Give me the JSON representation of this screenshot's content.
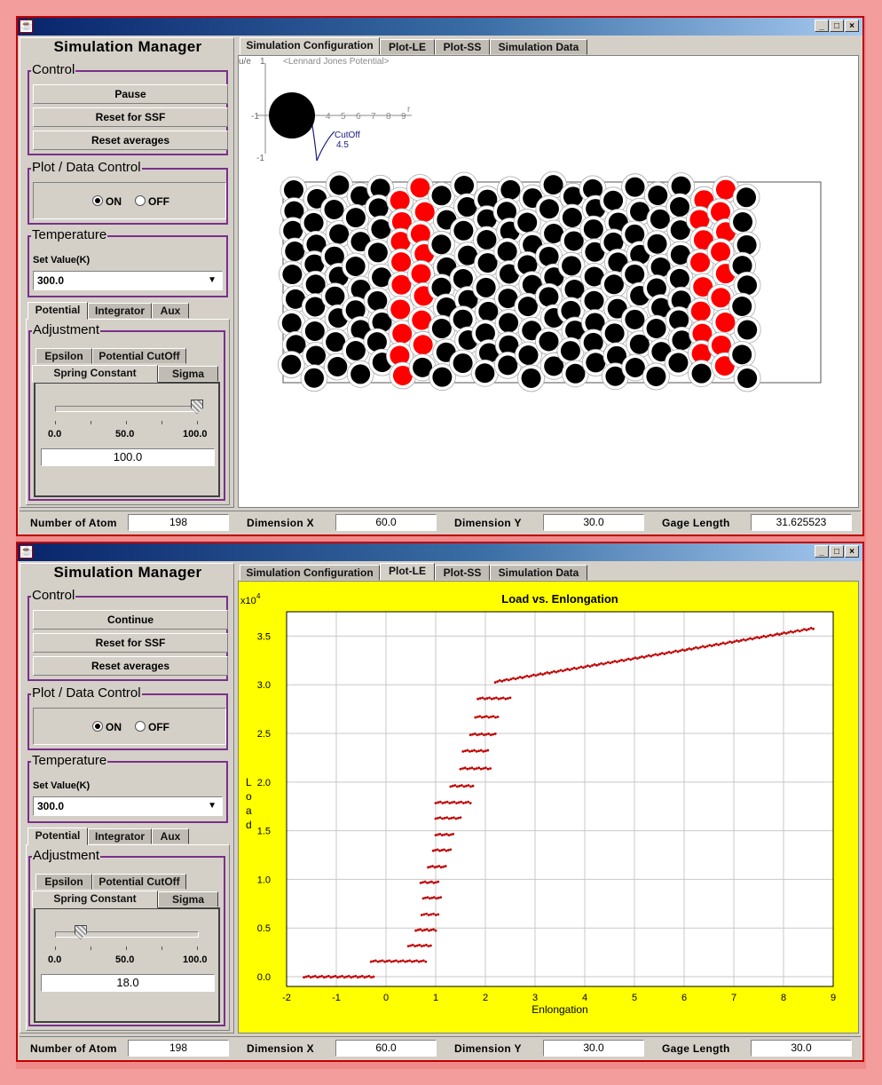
{
  "windows": [
    {
      "id": "win1",
      "manager_title": "Simulation Manager",
      "control": {
        "title": "Control",
        "buttons": [
          "Pause",
          "Reset for SSF",
          "Reset averages"
        ]
      },
      "plot_control": {
        "title": "Plot / Data Control",
        "on_label": "ON",
        "off_label": "OFF",
        "selected": "ON"
      },
      "temperature": {
        "title": "Temperature",
        "set_label": "Set Value(K)",
        "value": "300.0"
      },
      "side_tabs": [
        "Potential",
        "Integrator",
        "Aux"
      ],
      "adjustment": {
        "title": "Adjustment",
        "tabs_row1": [
          "Epsilon",
          "Potential CutOff"
        ],
        "tabs_row2": [
          "Spring Constant",
          "Sigma"
        ],
        "slider_min": "0.0",
        "slider_mid": "50.0",
        "slider_max": "100.0",
        "slider_fraction": 1.0,
        "value": "100.0"
      },
      "main_tabs": [
        "Simulation Configuration",
        "Plot-LE",
        "Plot-SS",
        "Simulation Data"
      ],
      "active_main_tab": 0,
      "status": {
        "atom_label": "Number of Atom",
        "atom_value": "198",
        "dimx_label": "Dimension X",
        "dimx_value": "60.0",
        "dimy_label": "Dimension Y",
        "dimy_value": "30.0",
        "gage_label": "Gage Length",
        "gage_value": "31.625523"
      },
      "potential_inset": {
        "ylabel": "u/e",
        "y_top": "1",
        "y_left": "-1",
        "y_bottom": "-1",
        "title": "<Lennard Jones Potential>",
        "x_ticks": [
          "4",
          "5",
          "6",
          "7",
          "8",
          "9"
        ],
        "x_axis": "r",
        "cutoff_label": "CutOff",
        "cutoff_value": "4.5"
      }
    },
    {
      "id": "win2",
      "manager_title": "Simulation Manager",
      "control": {
        "title": "Control",
        "buttons": [
          "Continue",
          "Reset for SSF",
          "Reset averages"
        ]
      },
      "plot_control": {
        "title": "Plot / Data Control",
        "on_label": "ON",
        "off_label": "OFF",
        "selected": "ON"
      },
      "temperature": {
        "title": "Temperature",
        "set_label": "Set Value(K)",
        "value": "300.0"
      },
      "side_tabs": [
        "Potential",
        "Integrator",
        "Aux"
      ],
      "adjustment": {
        "title": "Adjustment",
        "tabs_row1": [
          "Epsilon",
          "Potential CutOff"
        ],
        "tabs_row2": [
          "Spring Constant",
          "Sigma"
        ],
        "slider_min": "0.0",
        "slider_mid": "50.0",
        "slider_max": "100.0",
        "slider_fraction": 0.18,
        "value": "18.0"
      },
      "main_tabs": [
        "Simulation Configuration",
        "Plot-LE",
        "Plot-SS",
        "Simulation Data"
      ],
      "active_main_tab": 1,
      "status": {
        "atom_label": "Number of Atom",
        "atom_value": "198",
        "dimx_label": "Dimension X",
        "dimx_value": "60.0",
        "dimy_label": "Dimension Y",
        "dimy_value": "30.0",
        "gage_label": "Gage Length",
        "gage_value": "30.0"
      }
    }
  ],
  "colors": {
    "plot_background": "#ffff00",
    "data_points": "#c00000",
    "atom": "#000000",
    "highlight_atom": "#ff0000"
  },
  "chart_data": {
    "type": "scatter",
    "title": "Load vs. Enlongation",
    "xlabel": "Enlongation",
    "ylabel": "Load",
    "y_multiplier": "x10",
    "y_multiplier_exp": "4",
    "xlim": [
      -2,
      9
    ],
    "ylim": [
      -0.1,
      3.75
    ],
    "grid": true,
    "x_ticks": [
      "-2",
      "-1",
      "0",
      "1",
      "2",
      "3",
      "4",
      "5",
      "6",
      "7",
      "8",
      "9"
    ],
    "y_ticks": [
      "0.0",
      "0.5",
      "1.0",
      "1.5",
      "2.0",
      "2.5",
      "3.0",
      "3.5"
    ],
    "series": [
      {
        "segments": [
          {
            "x": [
              -1.65,
              -0.25
            ],
            "y": 0.0
          },
          {
            "x": [
              -0.3,
              0.8
            ],
            "y": 0.16
          },
          {
            "x": [
              0.45,
              0.9
            ],
            "y": 0.32
          },
          {
            "x": [
              0.6,
              1.0
            ],
            "y": 0.48
          },
          {
            "x": [
              0.72,
              1.05
            ],
            "y": 0.64
          },
          {
            "x": [
              0.75,
              1.1
            ],
            "y": 0.81
          },
          {
            "x": [
              0.7,
              1.05
            ],
            "y": 0.97
          },
          {
            "x": [
              0.85,
              1.2
            ],
            "y": 1.13
          },
          {
            "x": [
              0.95,
              1.3
            ],
            "y": 1.3
          },
          {
            "x": [
              1.0,
              1.35
            ],
            "y": 1.46
          },
          {
            "x": [
              1.0,
              1.5
            ],
            "y": 1.63
          },
          {
            "x": [
              1.0,
              1.7
            ],
            "y": 1.79
          },
          {
            "x": [
              1.3,
              1.75
            ],
            "y": 1.96
          },
          {
            "x": [
              1.5,
              2.1
            ],
            "y": 2.14
          },
          {
            "x": [
              1.55,
              2.05
            ],
            "y": 2.32
          },
          {
            "x": [
              1.7,
              2.2
            ],
            "y": 2.49
          },
          {
            "x": [
              1.8,
              2.25
            ],
            "y": 2.67
          },
          {
            "x": [
              1.85,
              2.5
            ],
            "y": 2.86
          },
          {
            "x": [
              2.2,
              8.6
            ],
            "y": [
              3.03,
              3.58
            ]
          }
        ]
      }
    ]
  }
}
